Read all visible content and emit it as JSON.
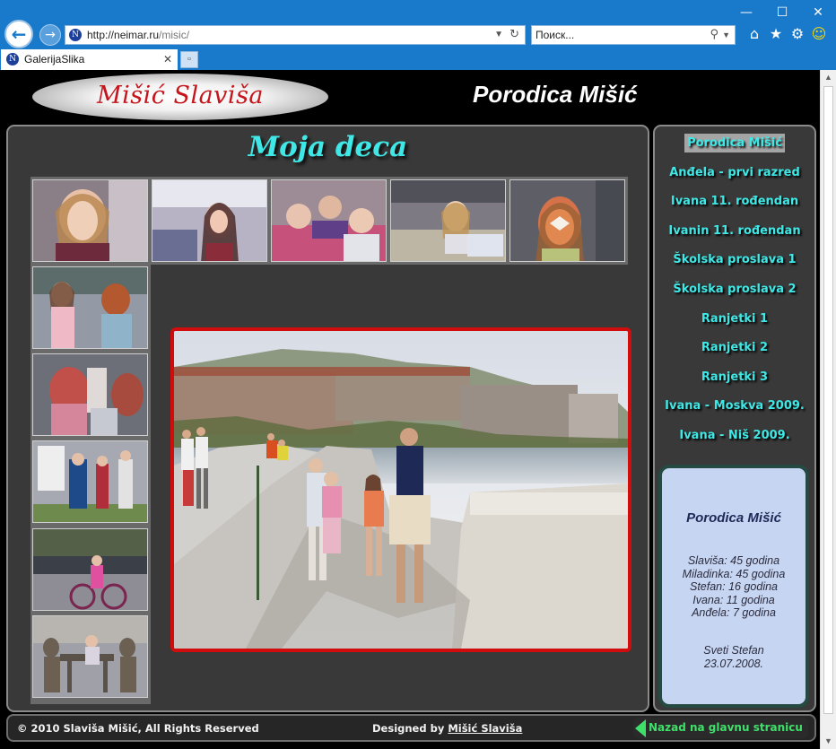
{
  "browser": {
    "address_url_host": "http://neimar.ru",
    "address_url_path": "/misic/",
    "search_placeholder": "Поиск...",
    "tab_title": "GalerijaSlika",
    "site_icon": "N",
    "window_controls": [
      "—",
      "☐",
      "✕"
    ]
  },
  "page": {
    "logo_text": "Mišić Slaviša",
    "site_title": "Porodica Mišić",
    "gallery_title": "Moja deca",
    "menu": [
      "Porodica Mišić",
      "Anđela - prvi razred",
      "Ivana 11. rođendan",
      "Ivanin 11. rođendan",
      "Školska proslava 1",
      "Školska proslava 2",
      "Ranjetki 1",
      "Ranjetki 2",
      "Ranjetki 3",
      "Ivana - Moskva 2009.",
      "Ivana - Niš 2009."
    ],
    "info": {
      "title": "Porodica Mišić",
      "lines": [
        "Slaviša: 45 godina",
        "Miladinka: 45 godina",
        "Stefan: 16 godina",
        "Ivana:  11 godina",
        "Anđela: 7 godina"
      ],
      "place": "Sveti Stefan",
      "date": "23.07.2008."
    },
    "footer": {
      "copyright": "© 2010 Slaviša Mišić, All Rights Reserved",
      "designed_by": "Designed by",
      "designer": "Mišić Slaviša",
      "back_link": "Nazad na glavnu stranicu"
    }
  },
  "colors": {
    "accent_cyan": "#3fe8e6",
    "photo_border": "#d10c0c",
    "browser_blue": "#1979ca",
    "back_link_green": "#3fe06a"
  }
}
